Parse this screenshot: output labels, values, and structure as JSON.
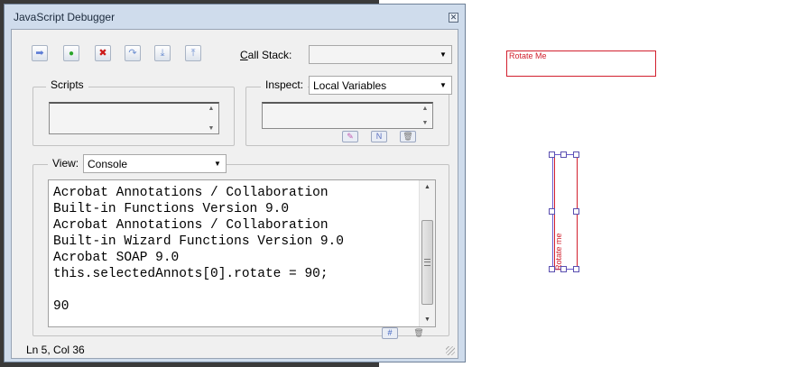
{
  "window": {
    "title": "JavaScript Debugger",
    "close_glyph": "⊠"
  },
  "toolbar": {
    "buttons": [
      {
        "name": "resume-button",
        "icon": "arrow-right-icon",
        "glyph": "➡"
      },
      {
        "name": "step-button",
        "icon": "green-dot-icon",
        "glyph": "●"
      },
      {
        "name": "stop-button",
        "icon": "red-x-icon",
        "glyph": "✖"
      },
      {
        "name": "step-over-button",
        "icon": "step-over-icon",
        "glyph": "↷"
      },
      {
        "name": "step-into-button",
        "icon": "step-into-icon",
        "glyph": "⤓"
      },
      {
        "name": "step-out-button",
        "icon": "step-out-icon",
        "glyph": "⤒"
      }
    ],
    "call_stack_label": "Call Stack:",
    "call_stack_access_key": "C",
    "call_stack_rest": "all Stack:",
    "call_stack_value": ""
  },
  "scripts": {
    "title": "Scripts"
  },
  "inspect": {
    "label": "Inspect:",
    "value": "Local Variables",
    "buttons": [
      {
        "name": "edit-variable-button",
        "icon": "pencil-icon",
        "glyph": "✎"
      },
      {
        "name": "new-watch-button",
        "icon": "watch-icon",
        "glyph": "N"
      },
      {
        "name": "delete-watch-button",
        "icon": "trash-icon",
        "glyph": "🗑"
      }
    ]
  },
  "view": {
    "label": "View:",
    "value": "Console",
    "console_lines": [
      "Acrobat Annotations / Collaboration",
      "Built-in Functions Version 9.0",
      "Acrobat Annotations / Collaboration",
      "Built-in Wizard Functions Version 9.0",
      "Acrobat SOAP 9.0",
      "this.selectedAnnots[0].rotate = 90;",
      "",
      "90"
    ],
    "clear_glyph": "#",
    "delete_glyph": "🗑"
  },
  "status": {
    "text": "Ln 5, Col 36"
  },
  "page": {
    "annotation_1_text": "Rotate Me",
    "annotation_2_text": "Rotate me"
  },
  "colors": {
    "annotation_red": "#d2202e",
    "selection_handles": "#5a4fb0",
    "window_frame": "#cfdcec"
  }
}
